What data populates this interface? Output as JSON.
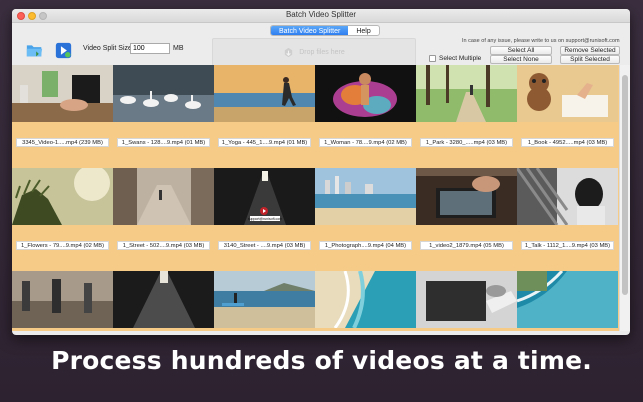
{
  "window": {
    "title": "Batch Video Splitter"
  },
  "tabs": [
    {
      "label": "Batch Video Splitter",
      "active": true
    },
    {
      "label": "Help",
      "active": false
    }
  ],
  "toolbar": {
    "open_folder_icon": "folder-open-icon",
    "add_video_icon": "video-add-icon",
    "split_size_label": "Video Split Size",
    "split_size_value": "100",
    "split_size_unit": "MB",
    "dropzone_text": "Drop files here",
    "support_text": "In case of any issue, please write to us on support@runisoft.com",
    "select_all": "Select All",
    "remove_selected": "Remove Selected",
    "select_multiple": "Select Multiple",
    "select_none": "Select None",
    "split_selected": "Split Selected"
  },
  "videos": [
    {
      "caption": "3345_Video-1.....mp4 (239 MB)",
      "scene": "desk"
    },
    {
      "caption": "1_Swans - 128....9.mp4 (01 MB)",
      "scene": "swans"
    },
    {
      "caption": "1_Yoga - 445_1....9.mp4 (01 MB)",
      "scene": "yoga"
    },
    {
      "caption": "1_Woman - 78....9.mp4 (02 MB)",
      "scene": "woman"
    },
    {
      "caption": "1_Park - 3280_.....mp4 (03 MB)",
      "scene": "park"
    },
    {
      "caption": "1_Book - 4952.....mp4 (03 MB)",
      "scene": "book"
    },
    {
      "caption": "1_Flowers - 79....9.mp4 (02 MB)",
      "scene": "flowers"
    },
    {
      "caption": "1_Street - 502....9.mp4 (03 MB)",
      "scene": "street"
    },
    {
      "caption": "3140_Street - ....9.mp4 (03 MB)",
      "scene": "alley"
    },
    {
      "caption": "1_Photograph....9.mp4 (04 MB)",
      "scene": "beach"
    },
    {
      "caption": "1_video2_1879.mp4 (05 MB)",
      "scene": "tablet"
    },
    {
      "caption": "1_Talk - 1112_1....9.mp4 (03 MB)",
      "scene": "talk"
    },
    {
      "caption": "",
      "scene": "people"
    },
    {
      "caption": "",
      "scene": "corridor"
    },
    {
      "caption": "",
      "scene": "surf"
    },
    {
      "caption": "",
      "scene": "ocean"
    },
    {
      "caption": "",
      "scene": "laptop"
    },
    {
      "caption": "",
      "scene": "aerial"
    }
  ],
  "support_watermark": "support@runisoft.com",
  "banner_text": "Process hundreds of videos at a time.",
  "colors": {
    "selection": "#f6cb88",
    "accent": "#2f7ef0",
    "background": "#2d2230"
  }
}
